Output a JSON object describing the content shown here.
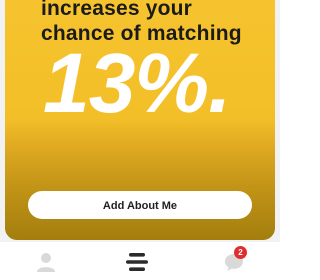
{
  "promo": {
    "headline_line1": "increases your",
    "headline_line2": "chance of matching",
    "percentage": "13%.",
    "cta_label": "Add About Me"
  },
  "nav": {
    "items": [
      {
        "icon": "profile-icon",
        "active": false
      },
      {
        "icon": "feed-icon",
        "active": true
      },
      {
        "icon": "messages-icon",
        "active": false,
        "badge": "2"
      }
    ]
  },
  "colors": {
    "card_top": "#f6c42f",
    "card_bottom": "#a37e0e",
    "headline": "#1b1b1b",
    "badge": "#e02e2e",
    "inactive_icon": "#d9d9d9",
    "active_icon": "#2b2b2b"
  }
}
